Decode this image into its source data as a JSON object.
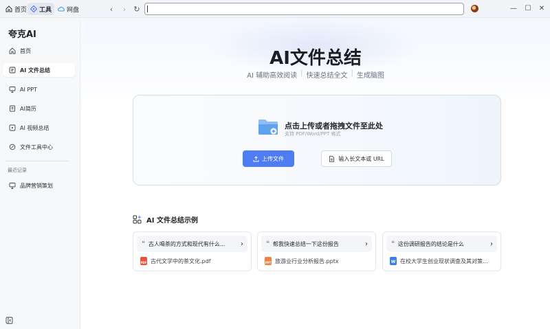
{
  "topbar": {
    "tabs": [
      {
        "label": "首页",
        "icon": "home-icon"
      },
      {
        "label": "工具",
        "icon": "tools-icon",
        "active": true
      },
      {
        "label": "网盘",
        "icon": "cloud-icon"
      }
    ],
    "address_value": ""
  },
  "sidebar": {
    "brand": "夸克AI",
    "items": [
      {
        "label": "首页",
        "icon": "home-icon"
      },
      {
        "label": "AI 文件总结",
        "icon": "file-summary-icon",
        "active": true
      },
      {
        "label": "AI PPT",
        "icon": "ppt-icon"
      },
      {
        "label": "AI简历",
        "icon": "resume-icon"
      },
      {
        "label": "AI 视频总结",
        "icon": "video-summary-icon"
      },
      {
        "label": "文件工具中心",
        "icon": "tools-center-icon"
      }
    ],
    "recent_label": "最近记录",
    "recent_items": [
      {
        "label": "品牌营销策划",
        "icon": "ppt-icon"
      }
    ]
  },
  "main": {
    "title": "AI文件总结",
    "subtitle_parts": [
      "AI 辅助高效阅读",
      "快速总结全文",
      "生成脑图"
    ],
    "upload": {
      "title": "点击上传或者拖拽文件至此处",
      "hint": "支持 PDF/Word/PPT 格式",
      "upload_button": "上传文件",
      "text_button": "输入长文本或 URL"
    },
    "examples_title": "AI 文件总结示例",
    "examples": [
      {
        "question": "古人喝茶的方式和现代有什么...",
        "file": "古代文学中的茶文化.pdf",
        "type": "PDF",
        "color": "#e8533c"
      },
      {
        "question": "帮我快速总结一下这份报告",
        "file": "旅游业行业分析报告.pptx",
        "type": "PPT",
        "color": "#f0804a"
      },
      {
        "question": "这份调研报告的结论是什么",
        "file": "在校大学生创业现状调查及其对策...",
        "type": "W",
        "color": "#3b7ee6"
      }
    ]
  },
  "colors": {
    "accent": "#4e7cf3",
    "active_bg": "#ffffff",
    "sidebar_bg": "#f7f8fa"
  }
}
